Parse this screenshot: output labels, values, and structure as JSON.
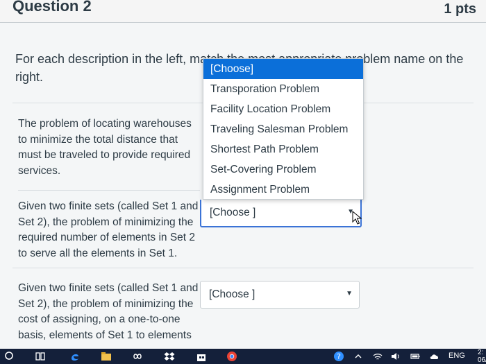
{
  "header": {
    "title": "Question 2",
    "points": "1 pts"
  },
  "instruction": "For each description in the left, match the most appropriate problem name on the right.",
  "items": [
    {
      "description": "The problem of locating warehouses to minimize the total distance that must be traveled to provide required services.",
      "selected": "[Choose]"
    },
    {
      "description": "Given two finite sets (called Set 1 and Set 2), the problem of minimizing the required number of elements in Set 2 to serve all the elements in Set 1.",
      "selected": "[Choose ]"
    },
    {
      "description": "Given two finite sets (called Set 1 and Set 2), the problem of minimizing the cost of assigning, on a one-to-one basis, elements of Set 1 to elements",
      "selected": "[Choose ]"
    }
  ],
  "dropdown": {
    "options": [
      "[Choose]",
      "Transporation Problem",
      "Facility Location Problem",
      "Traveling Salesman Problem",
      "Shortest Path Problem",
      "Set-Covering Problem",
      "Assignment Problem"
    ],
    "highlighted_index": 0
  },
  "taskbar": {
    "language": "ENG",
    "time": "2:",
    "date": "06/"
  },
  "colors": {
    "accent": "#0b6fd9",
    "taskbar": "#14203a",
    "text": "#2d3b45"
  }
}
